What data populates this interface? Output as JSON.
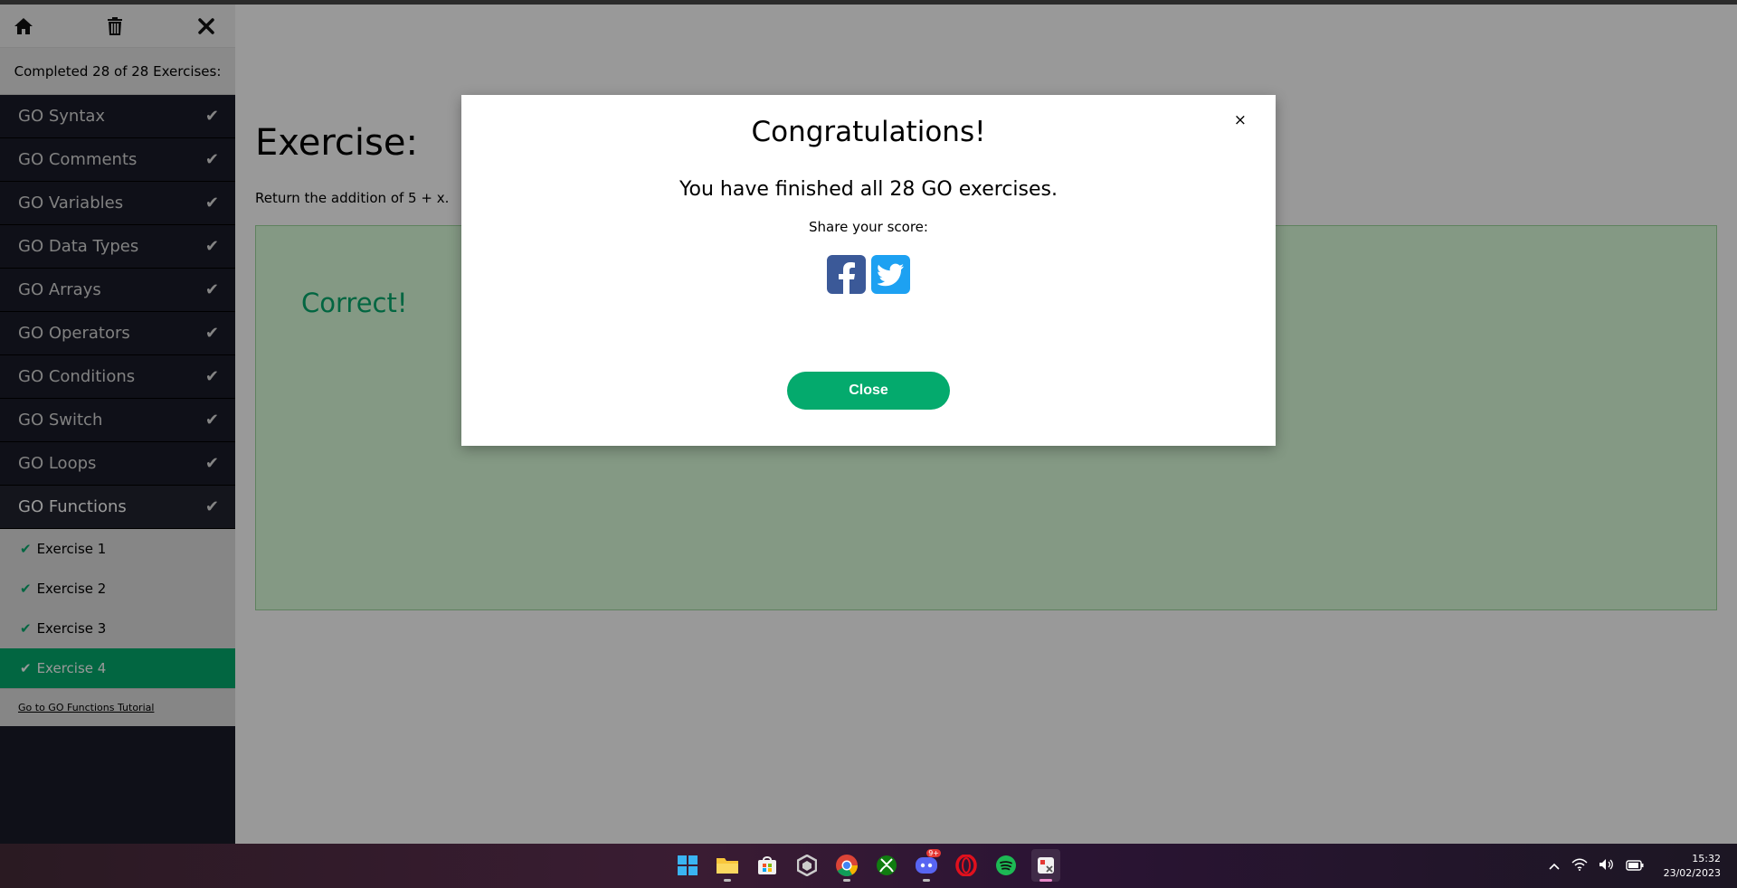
{
  "sidebar": {
    "progress_text": "Completed 28 of 28 Exercises:",
    "check_glyph": "✔",
    "chapters": [
      {
        "label": "GO Syntax"
      },
      {
        "label": "GO Comments"
      },
      {
        "label": "GO Variables"
      },
      {
        "label": "GO Data Types"
      },
      {
        "label": "GO Arrays"
      },
      {
        "label": "GO Operators"
      },
      {
        "label": "GO Conditions"
      },
      {
        "label": "GO Switch"
      },
      {
        "label": "GO Loops"
      },
      {
        "label": "GO Functions"
      }
    ],
    "exercises": [
      {
        "label": "Exercise 1"
      },
      {
        "label": "Exercise 2"
      },
      {
        "label": "Exercise 3"
      },
      {
        "label": "Exercise 4"
      }
    ],
    "tutorial_link": "Go to GO Functions Tutorial"
  },
  "main": {
    "title": "Exercise:",
    "description": "Return the addition of 5 + x.",
    "result": "Correct!"
  },
  "modal": {
    "close_x": "×",
    "title": "Congratulations!",
    "message": "You have finished all 28 GO exercises.",
    "share_label": "Share your score:",
    "close_button": "Close"
  },
  "taskbar": {
    "time": "15:32",
    "date": "23/02/2023",
    "discord_badge": "9+"
  },
  "colors": {
    "accent": "#04aa6d",
    "sidebar_bg": "#1a1c28",
    "facebook": "#3b5998",
    "twitter": "#1da1f2"
  }
}
